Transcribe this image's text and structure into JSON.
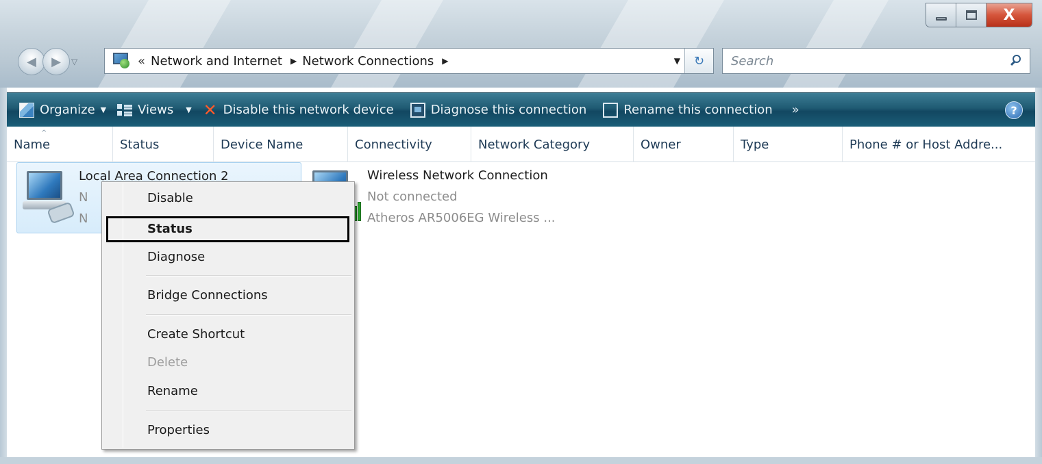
{
  "window": {
    "controls": {
      "minimize_icon": "minimize-icon",
      "maximize_icon": "maximize-icon",
      "close_glyph": "X"
    }
  },
  "nav": {
    "back_icon": "back-arrow-icon",
    "forward_icon": "forward-arrow-icon",
    "history_icon": "chevron-down-icon"
  },
  "address": {
    "overflow": "«",
    "crumbs": [
      "Network and Internet",
      "Network Connections"
    ],
    "separator": "▶",
    "dropdown": "▼",
    "refresh": "↻"
  },
  "search": {
    "placeholder": "Search"
  },
  "toolbar": {
    "organize": "Organize",
    "views": "Views",
    "disable": "Disable this network device",
    "diagnose": "Diagnose this connection",
    "rename": "Rename this connection",
    "more": "»",
    "help": "?"
  },
  "columns": [
    "Name",
    "Status",
    "Device Name",
    "Connectivity",
    "Network Category",
    "Owner",
    "Type",
    "Phone # or Host Addre..."
  ],
  "connections": [
    {
      "name": "Local Area Connection 2",
      "status": "N",
      "device": "N"
    },
    {
      "name": "Wireless Network Connection",
      "status": "Not connected",
      "device": "Atheros AR5006EG Wireless ..."
    }
  ],
  "context_menu": {
    "items": [
      "Disable",
      "Status",
      "Diagnose",
      "Bridge Connections",
      "Create Shortcut",
      "Delete",
      "Rename",
      "Properties"
    ]
  },
  "colors": {
    "command_bar": "#1f5a72",
    "selection": "#d7ecfb",
    "highlight_border": "#000000",
    "disabled_text": "#9d9d9d"
  }
}
